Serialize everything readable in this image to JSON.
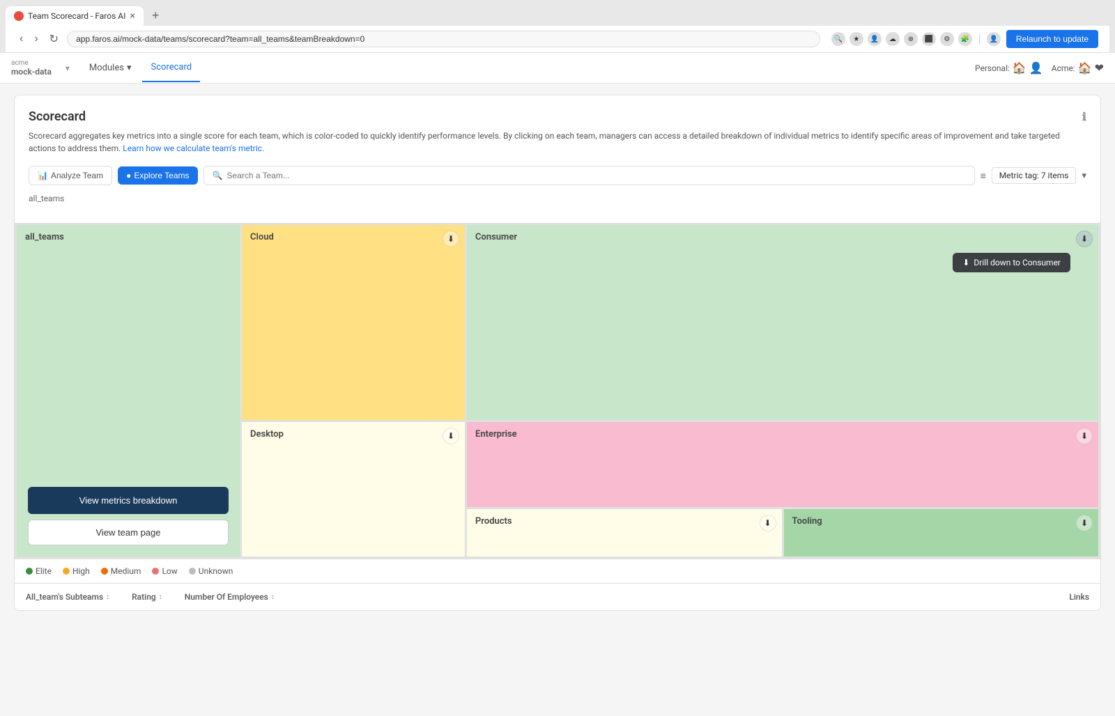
{
  "browser": {
    "tab_title": "Team Scorecard - Faros AI",
    "tab_close": "×",
    "new_tab": "+",
    "address": "app.faros.ai/mock-data/teams/scorecard?team=all_teams&teamBreakdown=0",
    "relaunch_label": "Relaunch to update"
  },
  "nav": {
    "workspace_org": "acme",
    "workspace_name": "mock-data",
    "modules_label": "Modules",
    "scorecard_label": "Scorecard",
    "personal_label": "Personal:",
    "acme_label": "Acme:"
  },
  "scorecard": {
    "title": "Scorecard",
    "description": "Scorecard aggregates key metrics into a single score for each team, which is color-coded to quickly identify performance levels. By clicking on each team, managers can access a detailed breakdown of individual metrics to identify specific areas of improvement and take targeted actions to address them.",
    "learn_link": "Learn how we calculate team's metric.",
    "analyze_label": "Analyze Team",
    "explore_label": "Explore Teams",
    "search_placeholder": "Search a Team...",
    "metric_tag": "Metric tag: 7 items",
    "breadcrumb": "all_teams"
  },
  "treemap": {
    "cells": [
      {
        "id": "all-teams",
        "label": "all_teams",
        "color": "#c8e6c9"
      },
      {
        "id": "cloud",
        "label": "Cloud",
        "color": "#ffe082"
      },
      {
        "id": "consumer",
        "label": "Consumer",
        "color": "#c8e6c9"
      },
      {
        "id": "enterprise",
        "label": "Enterprise",
        "color": "#f8bbd0"
      },
      {
        "id": "desktop",
        "label": "Desktop",
        "color": "#fffde7"
      },
      {
        "id": "products",
        "label": "Products",
        "color": "#fffde7"
      },
      {
        "id": "tooling",
        "label": "Tooling",
        "color": "#a5d6a7"
      }
    ],
    "drill_tooltip": "Drill down to Consumer",
    "view_metrics_label": "View metrics breakdown",
    "view_team_label": "View team page"
  },
  "legend": {
    "items": [
      {
        "label": "Elite",
        "color": "#388e3c"
      },
      {
        "label": "High",
        "color": "#f9a825"
      },
      {
        "label": "Medium",
        "color": "#f57f17"
      },
      {
        "label": "Low",
        "color": "#e57373"
      },
      {
        "label": "Unknown",
        "color": "#bdbdbd"
      }
    ]
  },
  "table": {
    "columns": [
      {
        "label": "All_team's Subteams",
        "sortable": true
      },
      {
        "label": "Rating",
        "sortable": true
      },
      {
        "label": "Number Of Employees",
        "sortable": true
      },
      {
        "label": "Links",
        "sortable": false
      }
    ]
  }
}
